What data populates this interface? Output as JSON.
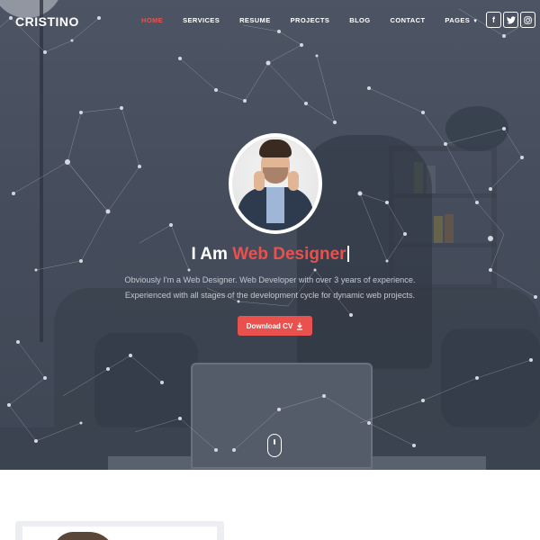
{
  "nav": {
    "logo": "CRISTINO",
    "items": [
      {
        "label": "HOME",
        "active": true
      },
      {
        "label": "SERVICES",
        "active": false
      },
      {
        "label": "RESUME",
        "active": false
      },
      {
        "label": "PROJECTS",
        "active": false
      },
      {
        "label": "BLOG",
        "active": false
      },
      {
        "label": "CONTACT",
        "active": false
      },
      {
        "label": "PAGES",
        "active": false,
        "has_dropdown": true
      }
    ],
    "social": [
      {
        "icon": "facebook-icon",
        "glyph": "f"
      },
      {
        "icon": "twitter-icon",
        "glyph": "🐦"
      },
      {
        "icon": "instagram-icon",
        "glyph": "◎"
      }
    ]
  },
  "hero": {
    "headline_prefix": "I Am ",
    "headline_accent": "Web Designer",
    "description_line1": "Obviously I'm a Web Designer. Web Developer with over 3 years of experience.",
    "description_line2": "Experienced with all stages of the development cycle for dynamic web projects.",
    "button_label": "Download CV",
    "button_icon": "download-icon"
  },
  "colors": {
    "accent": "#e9514f",
    "hero_overlay": "#4a5261",
    "text_light": "#ffffff",
    "text_muted": "#c4c8cf"
  }
}
